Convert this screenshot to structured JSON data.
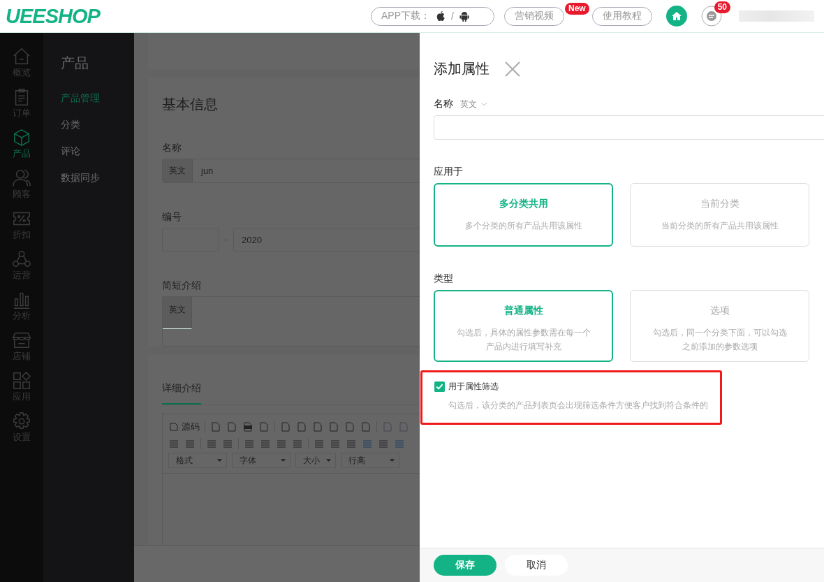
{
  "header": {
    "logo": "UEESHOP",
    "app_download": {
      "label": "APP下载：",
      "separator": "/"
    },
    "buttons": [
      {
        "label": "营销视频",
        "badge": "New"
      },
      {
        "label": "使用教程"
      }
    ],
    "messages_badge": "50"
  },
  "rail": [
    {
      "label": "概览",
      "selected": false
    },
    {
      "label": "订单",
      "selected": false
    },
    {
      "label": "产品",
      "selected": true
    },
    {
      "label": "顾客",
      "selected": false
    },
    {
      "label": "折扣",
      "selected": false
    },
    {
      "label": "运营",
      "selected": false
    },
    {
      "label": "分析",
      "selected": false
    },
    {
      "label": "店铺",
      "selected": false
    },
    {
      "label": "应用",
      "selected": false
    },
    {
      "label": "设置",
      "selected": false
    }
  ],
  "subnav": {
    "title": "产品",
    "items": [
      {
        "label": "产品管理",
        "selected": true
      },
      {
        "label": "分类",
        "selected": false
      },
      {
        "label": "评论",
        "selected": false
      },
      {
        "label": "数据同步",
        "selected": false
      }
    ]
  },
  "main": {
    "section_title": "基本信息",
    "name": {
      "label": "名称",
      "lang": "英文",
      "value": "jun"
    },
    "number": {
      "label": "编号",
      "separator": "-",
      "value": "2020"
    },
    "summary": {
      "label": "简短介绍",
      "lang": "英文"
    },
    "detail": {
      "tab": "详细介绍",
      "source_button": "源码",
      "dropdowns": [
        "格式",
        "字体",
        "大小",
        "行高"
      ]
    }
  },
  "drawer": {
    "title": "添加属性",
    "name": {
      "label": "名称",
      "lang": "英文"
    },
    "apply_to": {
      "label": "应用于",
      "options": [
        {
          "title": "多分类共用",
          "desc": "多个分类的所有产品共用该属性",
          "selected": true
        },
        {
          "title": "当前分类",
          "desc": "当前分类的所有产品共用该属性",
          "selected": false
        }
      ]
    },
    "type": {
      "label": "类型",
      "options": [
        {
          "title": "普通属性",
          "desc": "勾选后，具体的属性参数需在每一个产品内进行填写补充",
          "selected": true
        },
        {
          "title": "选项",
          "desc": "勾选后，同一个分类下面，可以勾选之前添加的参数选项",
          "selected": false
        }
      ]
    },
    "filter": {
      "label": "用于属性筛选",
      "checked": true,
      "hint": "勾选后，该分类的产品列表页会出现筛选条件方便客户找到符合条件的"
    },
    "buttons": {
      "save": "保存",
      "cancel": "取消"
    }
  }
}
